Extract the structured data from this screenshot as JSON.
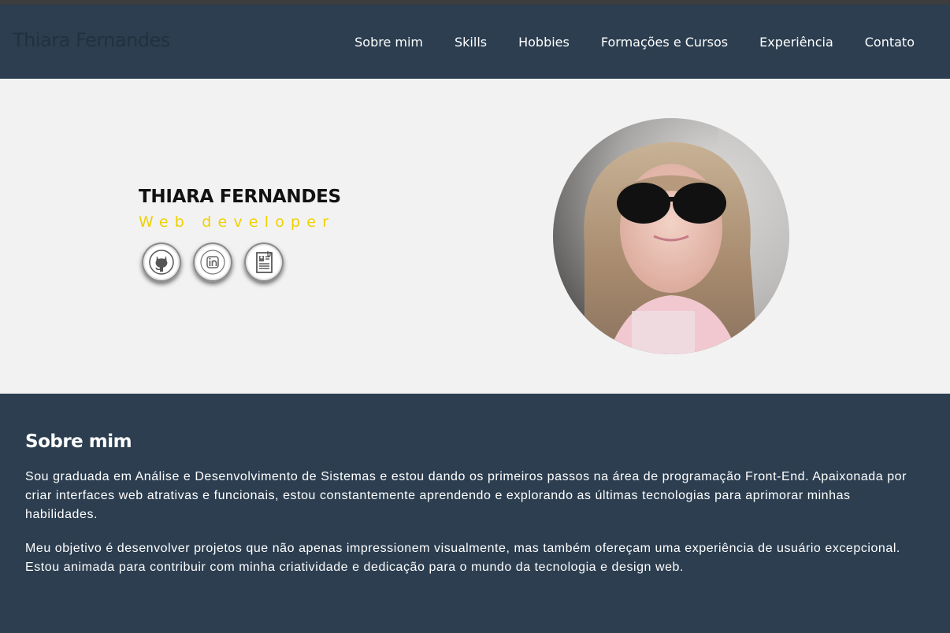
{
  "brand": "Thiara Fernandes",
  "nav": [
    {
      "label": "Sobre mim",
      "name": "nav-sobre-mim"
    },
    {
      "label": "Skills",
      "name": "nav-skills"
    },
    {
      "label": "Hobbies",
      "name": "nav-hobbies"
    },
    {
      "label": "Formações e Cursos",
      "name": "nav-formacoes-cursos"
    },
    {
      "label": "Experiência",
      "name": "nav-experiencia"
    },
    {
      "label": "Contato",
      "name": "nav-contato"
    }
  ],
  "hero": {
    "name": "THIARA FERNANDES",
    "role": "Web developer",
    "social": [
      {
        "icon": "github-icon"
      },
      {
        "icon": "linkedin-icon"
      },
      {
        "icon": "resume-icon"
      }
    ]
  },
  "about": {
    "title": "Sobre mim",
    "p1": "Sou graduada em Análise e Desenvolvimento de Sistemas e estou dando os primeiros passos na área de programação Front-End. Apaixonada por criar interfaces web atrativas e funcionais, estou constantemente aprendendo e explorando as últimas tecnologias para aprimorar minhas habilidades.",
    "p2": "Meu objetivo é desenvolver projetos que não apenas impressionem visualmente, mas também ofereçam uma experiência de usuário excepcional. Estou animada para contribuir com minha criatividade e dedicação para o mundo da tecnologia e design web."
  },
  "colors": {
    "navbar": "#2c3e50",
    "hero_bg": "#f2f2f2",
    "accent": "#f0d000"
  }
}
